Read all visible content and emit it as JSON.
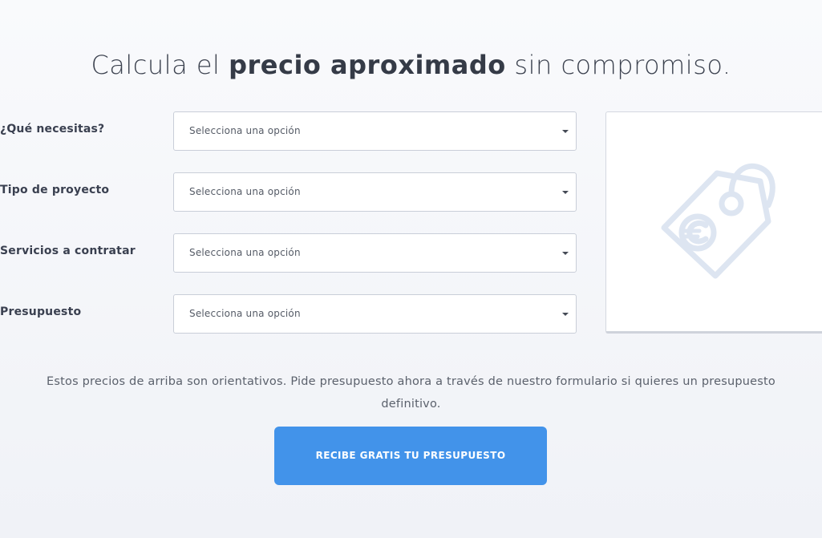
{
  "headline": {
    "prefix": "Calcula el ",
    "bold": "precio aproximado",
    "suffix": " sin compromiso."
  },
  "form": {
    "fields": [
      {
        "label": "¿Qué necesitas?",
        "value": "Selecciona una opción"
      },
      {
        "label": "Tipo de proyecto",
        "value": "Selecciona una opción"
      },
      {
        "label": "Servicios a contratar",
        "value": "Selecciona una opción"
      },
      {
        "label": "Presupuesto",
        "value": "Selecciona una opción"
      }
    ]
  },
  "illustration": {
    "icon": "euro-price-tag-icon",
    "color": "#dde5f1"
  },
  "disclaimer": "Estos precios de arriba son orientativos. Pide presupuesto ahora a través de nuestro formulario si quieres un presupuesto definitivo.",
  "cta": {
    "label": "RECIBE GRATIS TU PRESUPUESTO",
    "color": "#4293ea"
  }
}
